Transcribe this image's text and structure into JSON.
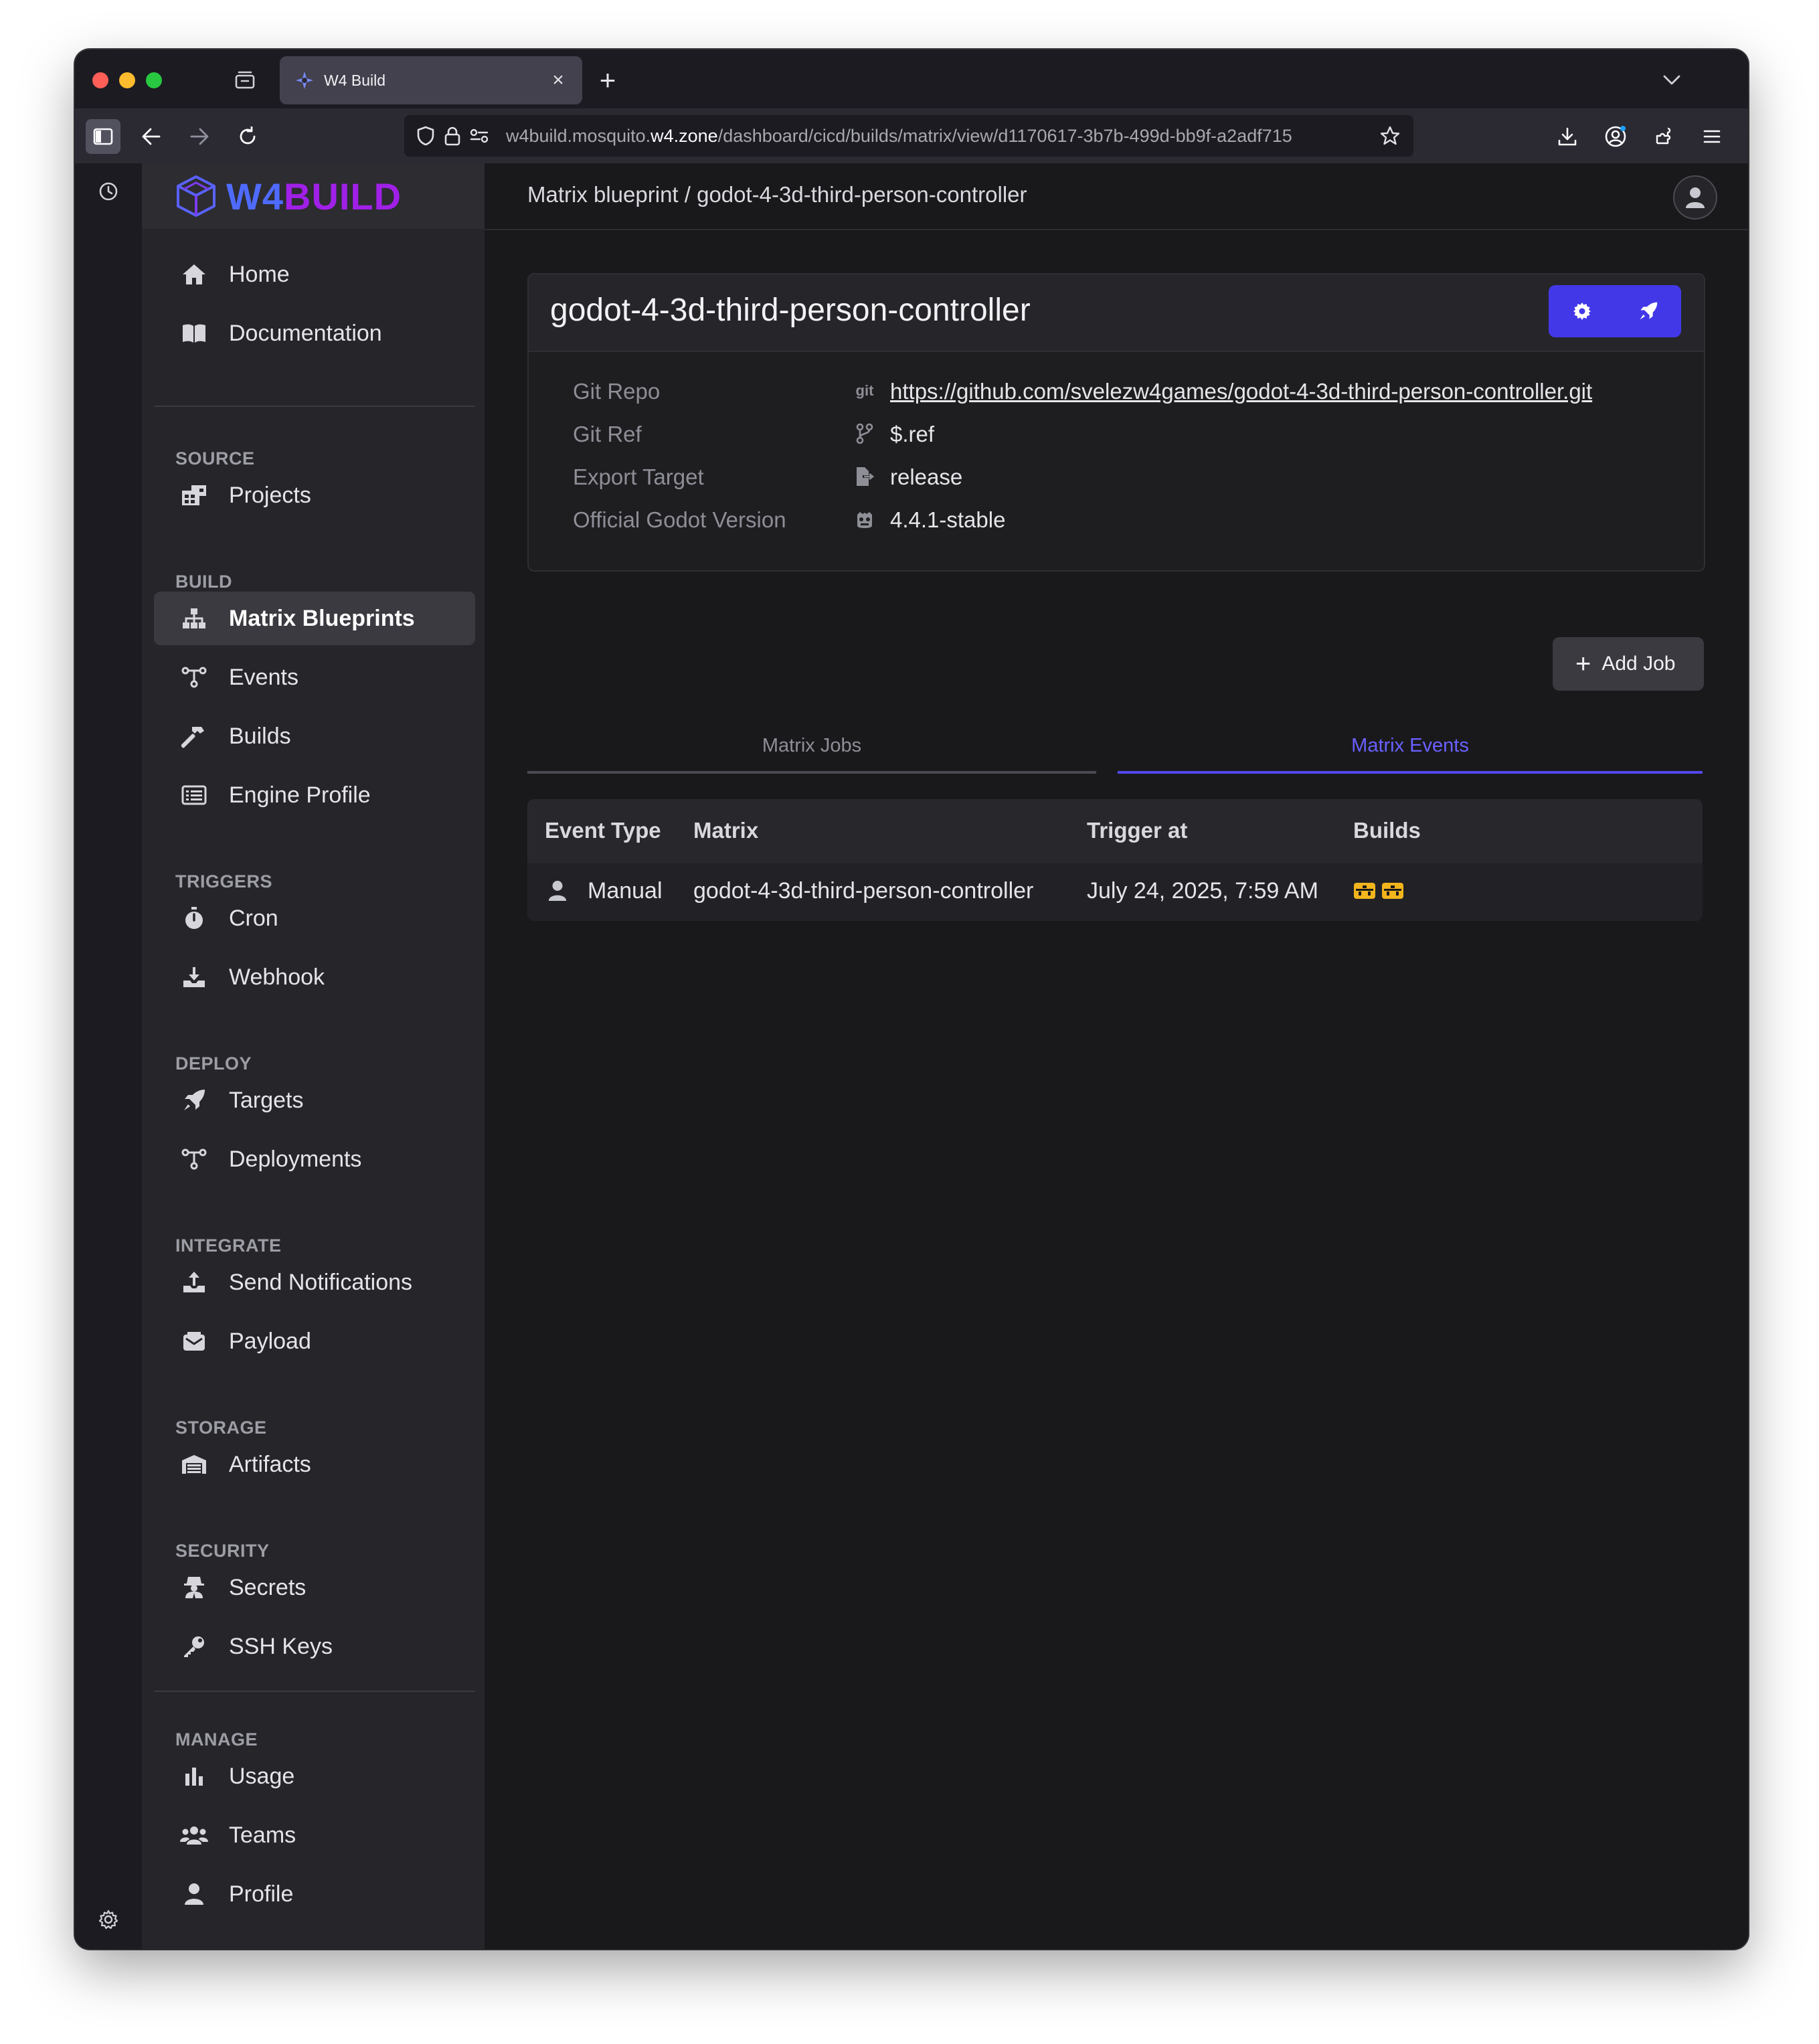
{
  "browser": {
    "tab_title": "W4 Build",
    "url_prefix": "w4build.mosquito.",
    "url_domain": "w4.zone",
    "url_path": "/dashboard/cicd/builds/matrix/view/d1170617-3b7b-499d-bb9f-a2adf715",
    "icons": [
      "sidebar-toggle-icon",
      "back-icon",
      "forward-icon",
      "reload-icon",
      "shield-icon",
      "lock-icon",
      "permissions-icon",
      "bookmark-star-icon",
      "download-icon",
      "account-icon",
      "extensions-icon",
      "menu-icon",
      "history-icon",
      "settings-gear-icon"
    ]
  },
  "brand": {
    "w4": "W4",
    "build": "BUILD",
    "w4_color": "#4f6bff",
    "build_color": "#a020e8"
  },
  "sidebar": {
    "top": [
      {
        "label": "Home",
        "icon": "home-icon"
      },
      {
        "label": "Documentation",
        "icon": "book-icon"
      }
    ],
    "source_header": "SOURCE",
    "source": [
      {
        "label": "Projects",
        "icon": "projects-icon"
      }
    ],
    "build_header": "BUILD",
    "build": [
      {
        "label": "Matrix Blueprints",
        "icon": "sitemap-icon",
        "active": true
      },
      {
        "label": "Events",
        "icon": "events-icon"
      },
      {
        "label": "Builds",
        "icon": "hammer-icon"
      },
      {
        "label": "Engine Profile",
        "icon": "list-icon"
      }
    ],
    "triggers_header": "TRIGGERS",
    "triggers": [
      {
        "label": "Cron",
        "icon": "stopwatch-icon"
      },
      {
        "label": "Webhook",
        "icon": "download-tray-icon"
      }
    ],
    "deploy_header": "DEPLOY",
    "deploy": [
      {
        "label": "Targets",
        "icon": "rocket-icon"
      },
      {
        "label": "Deployments",
        "icon": "deployments-icon"
      }
    ],
    "integrate_header": "INTEGRATE",
    "integrate": [
      {
        "label": "Send Notifications",
        "icon": "upload-tray-icon"
      },
      {
        "label": "Payload",
        "icon": "envelope-icon"
      }
    ],
    "storage_header": "STORAGE",
    "storage": [
      {
        "label": "Artifacts",
        "icon": "warehouse-icon"
      }
    ],
    "security_header": "SECURITY",
    "security": [
      {
        "label": "Secrets",
        "icon": "user-secret-icon"
      },
      {
        "label": "SSH Keys",
        "icon": "key-icon"
      }
    ],
    "manage_header": "MANAGE",
    "manage": [
      {
        "label": "Usage",
        "icon": "bar-chart-icon"
      },
      {
        "label": "Teams",
        "icon": "users-icon"
      },
      {
        "label": "Profile",
        "icon": "user-icon"
      }
    ]
  },
  "header": {
    "breadcrumb": "Matrix blueprint / godot-4-3d-third-person-controller"
  },
  "blueprint": {
    "title": "godot-4-3d-third-person-controller",
    "git_repo_label": "Git Repo",
    "git_repo_icon_text": "git",
    "git_repo_value": "https://github.com/svelezw4games/godot-4-3d-third-person-controller.git",
    "git_ref_label": "Git Ref",
    "git_ref_value": "$.ref",
    "export_target_label": "Export Target",
    "export_target_value": "release",
    "godot_version_label": "Official Godot Version",
    "godot_version_value": "4.4.1-stable",
    "accent_color": "#4338e8"
  },
  "actions": {
    "add_job": "Add Job"
  },
  "tabs": {
    "jobs": "Matrix Jobs",
    "events": "Matrix Events",
    "active": "events"
  },
  "events_table": {
    "headers": {
      "event_type": "Event Type",
      "matrix": "Matrix",
      "trigger_at": "Trigger at",
      "builds": "Builds"
    },
    "rows": [
      {
        "event_type": "Manual",
        "matrix": "godot-4-3d-third-person-controller",
        "trigger_at": "July 24, 2025, 7:59 AM",
        "builds_count": 2,
        "build_status_color": "#f2b51c"
      }
    ]
  }
}
